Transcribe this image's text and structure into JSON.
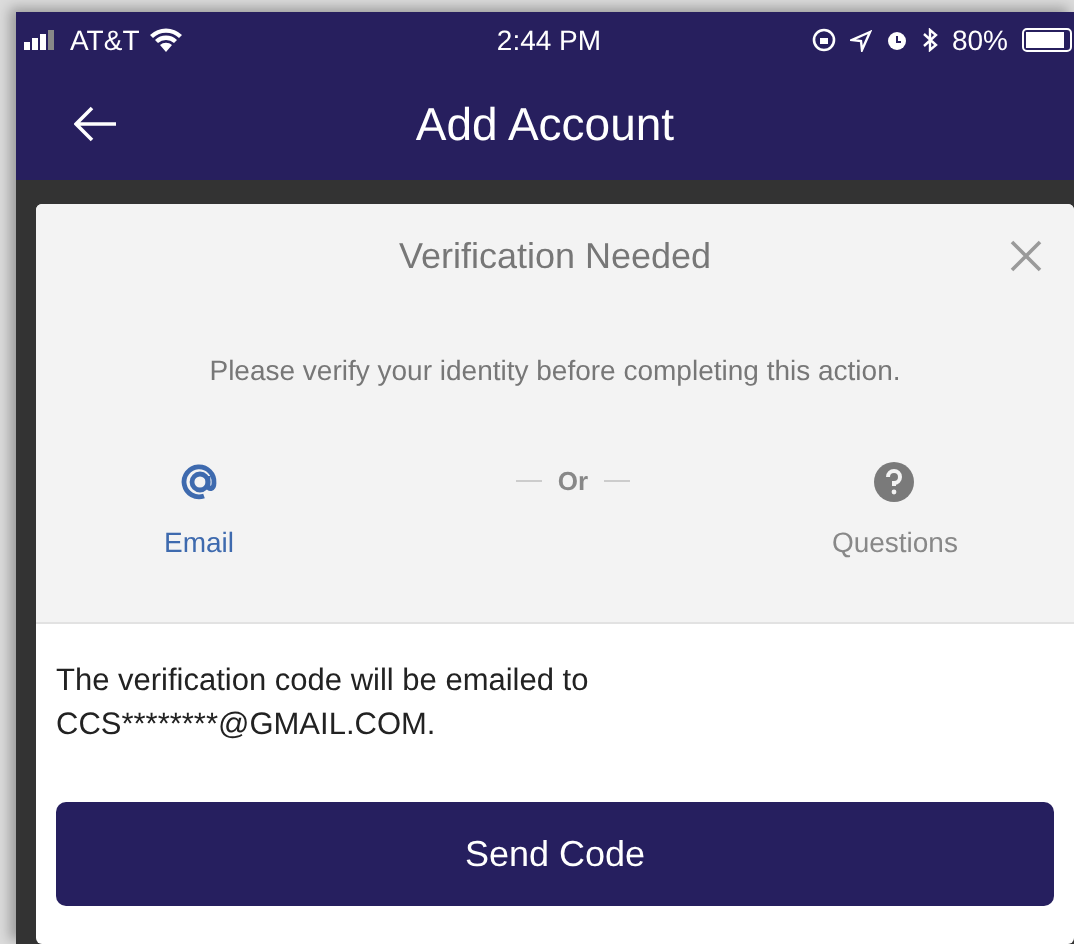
{
  "status_bar": {
    "carrier": "AT&T",
    "time": "2:44 PM",
    "battery": "80%"
  },
  "nav_bar": {
    "title": "Add Account"
  },
  "dialog": {
    "title": "Verification Needed",
    "message": "Please verify your identity before completing this action.",
    "methods": [
      {
        "kind": "email",
        "label": "Email",
        "selected": true
      },
      {
        "kind": "questions",
        "label": "Questions",
        "selected": false
      }
    ],
    "separator": "Or",
    "info": "The verification code will be emailed to CCS********@GMAIL.COM.",
    "button": "Send Code"
  }
}
